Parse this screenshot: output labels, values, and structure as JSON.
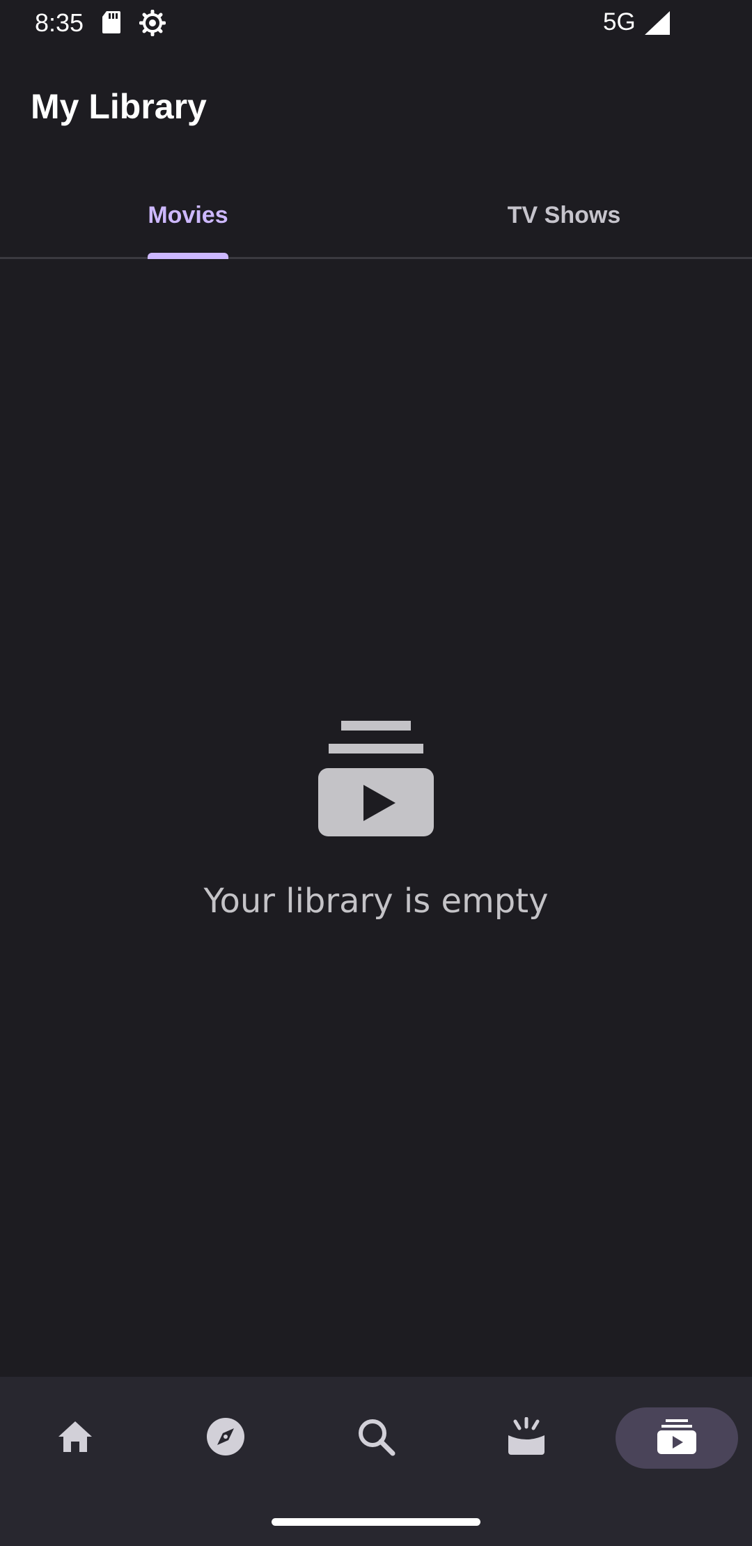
{
  "status_bar": {
    "time": "8:35",
    "network": "5G",
    "icons": [
      "sd-card-icon",
      "gear-icon",
      "signal-icon"
    ]
  },
  "header": {
    "title": "My Library"
  },
  "tabs": [
    {
      "label": "Movies",
      "selected": true
    },
    {
      "label": "TV Shows",
      "selected": false
    }
  ],
  "empty_state": {
    "icon": "video-library-icon",
    "message": "Your library is empty"
  },
  "bottom_nav": {
    "items": [
      {
        "icon": "home-icon",
        "selected": false
      },
      {
        "icon": "compass-icon",
        "selected": false
      },
      {
        "icon": "search-icon",
        "selected": false
      },
      {
        "icon": "live-tv-icon",
        "selected": false
      },
      {
        "icon": "library-icon",
        "selected": true
      }
    ]
  },
  "colors": {
    "background": "#1d1c21",
    "accent": "#cdb8ff",
    "nav_background": "#28272f",
    "nav_selected": "#4a4459",
    "muted_text": "#c4c3c7"
  }
}
